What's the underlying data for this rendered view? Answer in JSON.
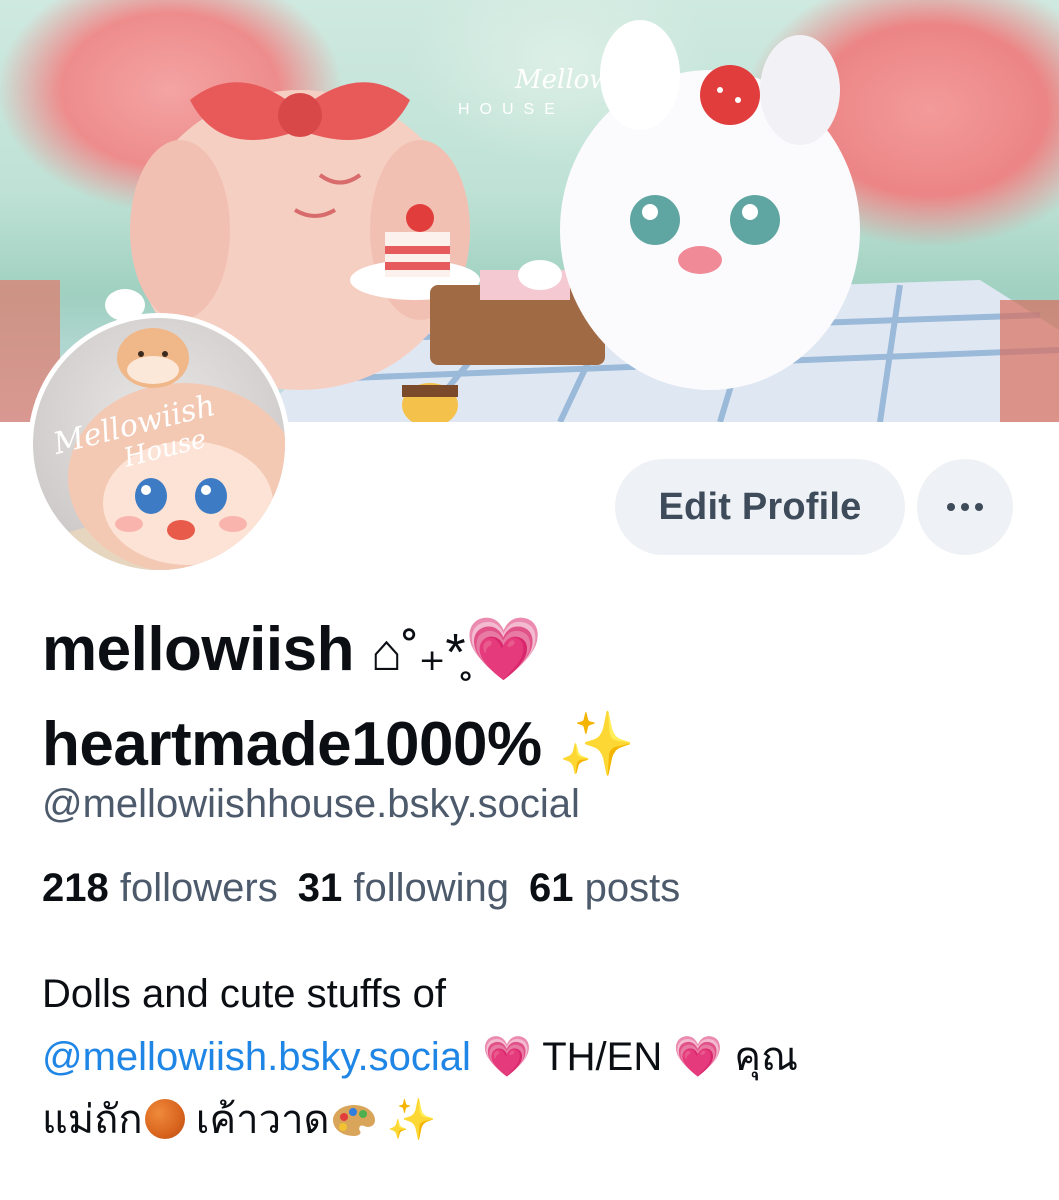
{
  "banner": {
    "logo_line1": "Mellowiish",
    "logo_line2": "HOUSE"
  },
  "avatar": {
    "logo_line1": "Mellowiish",
    "logo_line2": "House"
  },
  "actions": {
    "edit_profile": "Edit Profile",
    "more_menu": "..."
  },
  "profile": {
    "display_name_line1": "mellowiish",
    "display_name_deco": "⌂˚₊*̥",
    "display_name_heart": "💗",
    "display_name_line2": "heartmade1000%",
    "display_name_spark": "✨",
    "handle": "@mellowiishhouse.bsky.social"
  },
  "stats": {
    "followers_count": "218",
    "followers_label": "followers",
    "following_count": "31",
    "following_label": "following",
    "posts_count": "61",
    "posts_label": "posts"
  },
  "bio": {
    "line1": "Dolls and cute stuffs of",
    "mention": "@mellowiish.bsky.social",
    "heart1": "💗",
    "lang": "TH/EN",
    "heart2": "💗",
    "thai1": "คุณ",
    "thai2": "แม่ถัก",
    "thai3": "เค้าวาด",
    "spark": "✨"
  },
  "colors": {
    "link": "#1f86e6",
    "muted": "#4c5a6b",
    "button_bg": "#eef1f5",
    "heart": "#ee5aa9"
  }
}
